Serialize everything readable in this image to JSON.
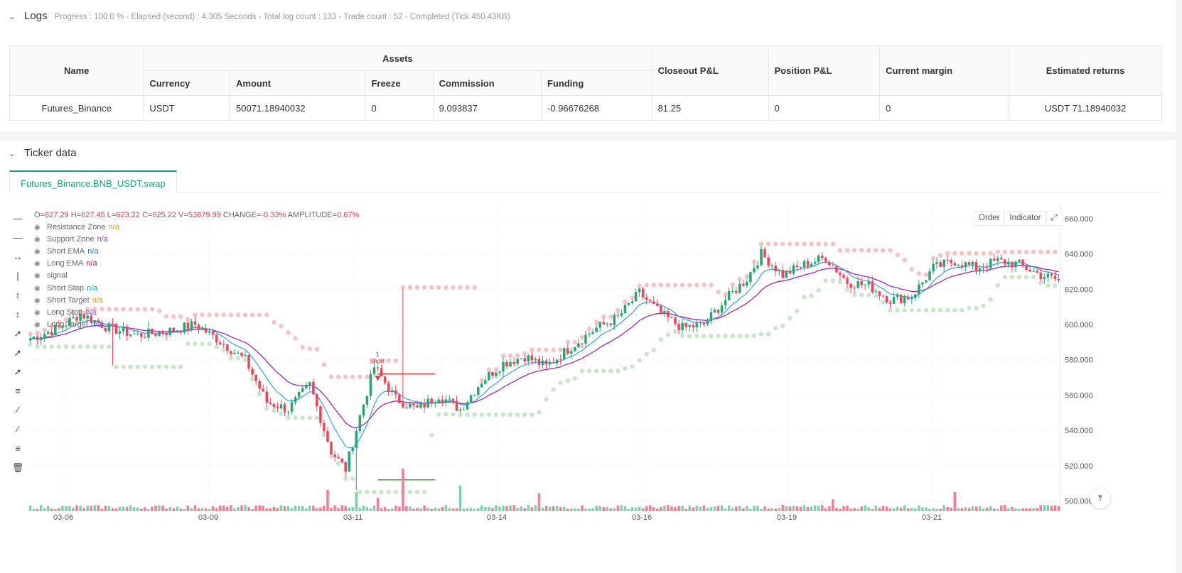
{
  "logs": {
    "title": "Logs",
    "summary": "Progress : 100.0 % - Elapsed (second) : 4.305 Seconds - Total log count : 133 - Trade count : 52 - Completed (Tick 450.43KB)"
  },
  "assets_table": {
    "group_header": "Assets",
    "headers": {
      "name": "Name",
      "currency": "Currency",
      "amount": "Amount",
      "freeze": "Freeze",
      "commission": "Commission",
      "funding": "Funding",
      "closeout_pnl": "Closeout P&L",
      "position_pnl": "Position P&L",
      "current_margin": "Current margin",
      "estimated_returns": "Estimated returns"
    },
    "row": {
      "name": "Futures_Binance",
      "currency": "USDT",
      "amount": "50071.18940032",
      "freeze": "0",
      "commission": "9.093837",
      "funding": "-0.96676268",
      "closeout_pnl": "81.25",
      "position_pnl": "0",
      "current_margin": "0",
      "estimated_returns": "USDT 71.18940032"
    }
  },
  "ticker": {
    "title": "Ticker data",
    "tab_label": "Futures_Binance.BNB_USDT.swap"
  },
  "legend": {
    "ohlc": {
      "o": "627.29",
      "h": "627.45",
      "l": "623.22",
      "c": "625.22",
      "v": "53879.99",
      "change": "-0.33%",
      "amplitude": "0.67%"
    },
    "items": [
      {
        "label": "Resistance Zone",
        "value": "n/a",
        "color": "#f39c12"
      },
      {
        "label": "Support Zone",
        "value": "n/a",
        "color": "#8e44ad"
      },
      {
        "label": "Short EMA",
        "value": "n/a",
        "color": "#2979ff"
      },
      {
        "label": "Long EMA",
        "value": "n/a",
        "color": "#c2185b"
      },
      {
        "label": "signal",
        "value": "",
        "color": "#666666"
      },
      {
        "label": "Short Stop",
        "value": "n/a",
        "color": "#00acc1"
      },
      {
        "label": "Short Target",
        "value": "n/a",
        "color": "#f39c12"
      },
      {
        "label": "Long Stop",
        "value": "n/a",
        "color": "#7c4dff"
      },
      {
        "label": "Long Target",
        "value": "n/a",
        "color": "#2979ff"
      }
    ]
  },
  "chart_buttons": {
    "order": "Order",
    "indicator": "Indicator"
  },
  "chart_data": {
    "type": "candlestick",
    "y_ticks": [
      "500.000",
      "520.000",
      "540.000",
      "560.000",
      "580.000",
      "600.000",
      "620.000",
      "640.000",
      "660.000"
    ],
    "ylim": [
      495,
      668
    ],
    "x_ticks": [
      "03-06",
      "03-09",
      "03-11",
      "03-14",
      "03-16",
      "03-19",
      "03-21"
    ],
    "signal": {
      "text_1": "1",
      "text_2": "Short"
    },
    "anchors": [
      [
        0,
        592
      ],
      [
        8,
        598
      ],
      [
        14,
        606
      ],
      [
        22,
        598
      ],
      [
        30,
        594
      ],
      [
        38,
        596
      ],
      [
        46,
        600
      ],
      [
        52,
        592
      ],
      [
        60,
        580
      ],
      [
        66,
        556
      ],
      [
        72,
        552
      ],
      [
        78,
        566
      ],
      [
        84,
        528
      ],
      [
        88,
        518
      ],
      [
        92,
        548
      ],
      [
        96,
        576
      ],
      [
        102,
        558
      ],
      [
        108,
        552
      ],
      [
        114,
        560
      ],
      [
        120,
        552
      ],
      [
        126,
        568
      ],
      [
        132,
        578
      ],
      [
        138,
        582
      ],
      [
        144,
        576
      ],
      [
        150,
        586
      ],
      [
        158,
        598
      ],
      [
        164,
        604
      ],
      [
        170,
        618
      ],
      [
        176,
        606
      ],
      [
        182,
        598
      ],
      [
        188,
        600
      ],
      [
        194,
        614
      ],
      [
        200,
        626
      ],
      [
        204,
        640
      ],
      [
        210,
        628
      ],
      [
        216,
        634
      ],
      [
        222,
        638
      ],
      [
        228,
        624
      ],
      [
        234,
        622
      ],
      [
        240,
        614
      ],
      [
        246,
        616
      ],
      [
        252,
        632
      ],
      [
        258,
        636
      ],
      [
        264,
        632
      ],
      [
        270,
        636
      ],
      [
        276,
        634
      ],
      [
        282,
        628
      ],
      [
        287,
        625
      ]
    ],
    "volume_spikes": [
      [
        104,
        1.0
      ],
      [
        83,
        0.5
      ],
      [
        91,
        0.45
      ],
      [
        97,
        0.32
      ],
      [
        120,
        0.6
      ],
      [
        142,
        0.42
      ],
      [
        258,
        0.45
      ],
      [
        224,
        0.28
      ]
    ]
  }
}
